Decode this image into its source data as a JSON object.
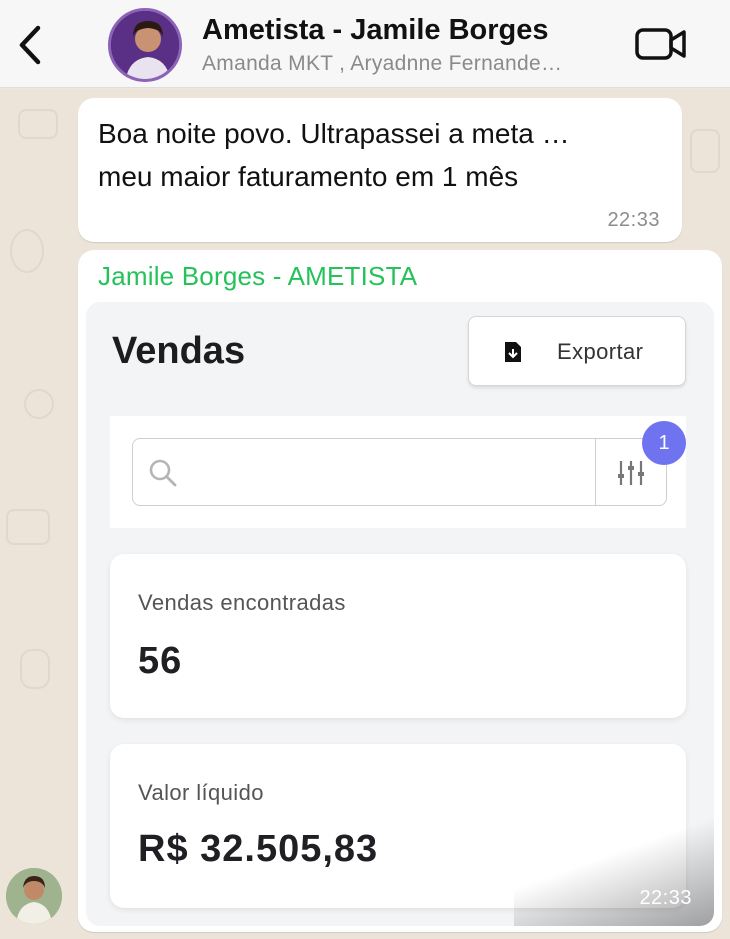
{
  "header": {
    "title": "Ametista - Jamile Borges",
    "subtitle": "Amanda MKT , Aryadnne Fernande…",
    "back_icon": "chevron-left-icon",
    "video_icon": "video-call-icon"
  },
  "messages": [
    {
      "text_line1": "Boa noite povo. Ultrapassei a meta …",
      "text_line2": "meu maior faturamento em 1 mês",
      "time": "22:33"
    },
    {
      "sender": "Jamile Borges - AMETISTA",
      "time": "22:33",
      "screenshot": {
        "page_title": "Vendas",
        "export_label": "Exportar",
        "filter_badge": "1",
        "cards": [
          {
            "label": "Vendas encontradas",
            "value": "56"
          },
          {
            "label": "Valor líquido",
            "value": "R$ 32.505,83"
          }
        ]
      }
    }
  ],
  "colors": {
    "sender_name": "#25c25a",
    "badge": "#6f73ef",
    "chat_bg": "#ece4d9"
  }
}
